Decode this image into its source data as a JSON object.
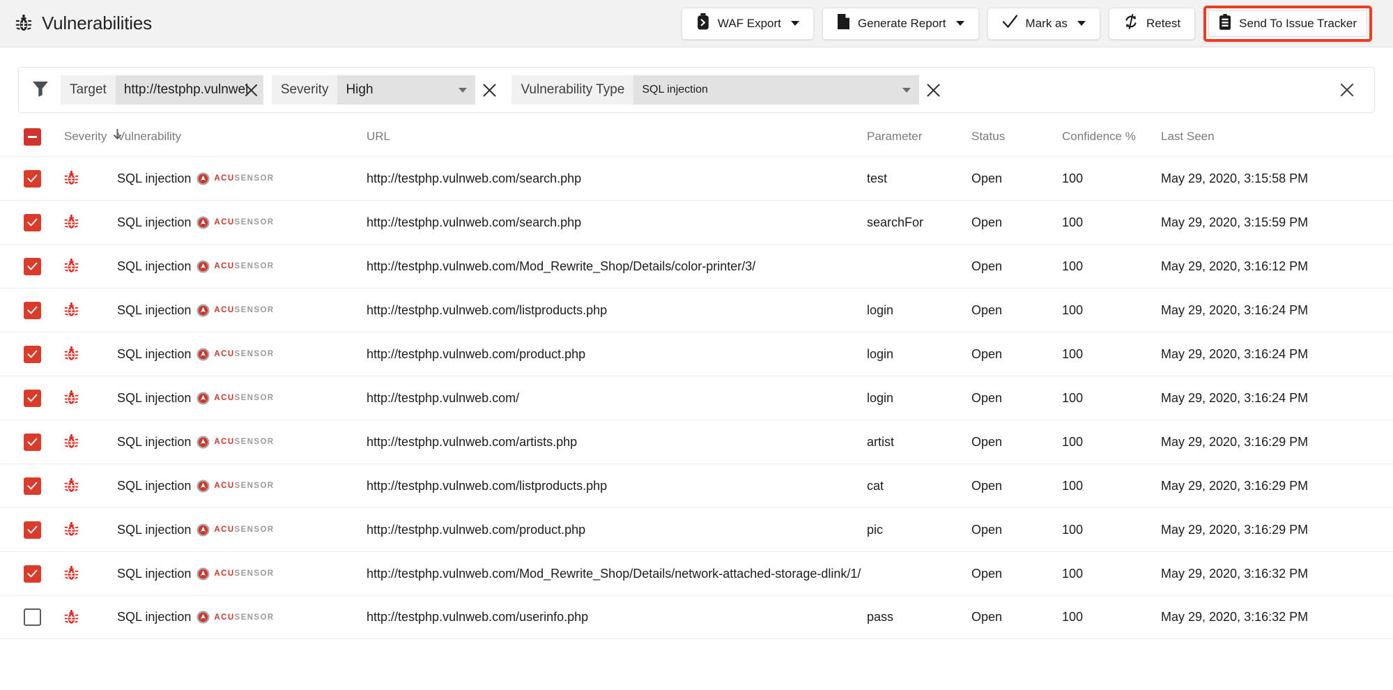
{
  "header": {
    "title": "Vulnerabilities",
    "icon": "bug-icon",
    "buttons": [
      {
        "label": "WAF Export",
        "icon": "waf-export-icon",
        "has_caret": true,
        "highlighted": false
      },
      {
        "label": "Generate Report",
        "icon": "document-icon",
        "has_caret": true,
        "highlighted": false
      },
      {
        "label": "Mark as",
        "icon": "check-icon",
        "has_caret": true,
        "highlighted": false
      },
      {
        "label": "Retest",
        "icon": "refresh-icon",
        "has_caret": false,
        "highlighted": false
      },
      {
        "label": "Send To Issue Tracker",
        "icon": "clipboard-icon",
        "has_caret": false,
        "highlighted": true
      }
    ],
    "highlight_color": "#ef3b24"
  },
  "filters": {
    "icon": "filter-funnel-icon",
    "clear_all_icon": "close-icon",
    "items": [
      {
        "key": "Target",
        "value": "http://testphp.vulnwel",
        "has_caret": false,
        "clear_icon": "close-icon"
      },
      {
        "key": "Severity",
        "value": "High",
        "has_caret": true,
        "clear_icon": "close-icon"
      },
      {
        "key": "Vulnerability Type",
        "value": "SQL injection",
        "has_caret": true,
        "clear_icon": "close-icon"
      }
    ]
  },
  "table": {
    "select_all_state": "indeterminate",
    "columns": [
      {
        "id": "severity",
        "label": "Severity",
        "sorted": true,
        "sort_dir": "down",
        "sort_icon": "arrow-down-icon"
      },
      {
        "id": "vulnerability",
        "label": "Vulnerability",
        "sorted": false
      },
      {
        "id": "url",
        "label": "URL",
        "sorted": false
      },
      {
        "id": "parameter",
        "label": "Parameter",
        "sorted": false
      },
      {
        "id": "status",
        "label": "Status",
        "sorted": false
      },
      {
        "id": "confidence",
        "label": "Confidence %",
        "sorted": false
      },
      {
        "id": "last_seen",
        "label": "Last Seen",
        "sorted": false
      }
    ],
    "badge": {
      "mark": "acusensor-logo-icon",
      "text_a": "ACU",
      "text_b": "SENSOR"
    },
    "severity_icon": "red-bug-icon",
    "rows": [
      {
        "selected": true,
        "vulnerability": "SQL injection",
        "url": "http://testphp.vulnweb.com/search.php",
        "parameter": "test",
        "status": "Open",
        "confidence": "100",
        "last_seen": "May 29, 2020, 3:15:58 PM"
      },
      {
        "selected": true,
        "vulnerability": "SQL injection",
        "url": "http://testphp.vulnweb.com/search.php",
        "parameter": "searchFor",
        "status": "Open",
        "confidence": "100",
        "last_seen": "May 29, 2020, 3:15:59 PM"
      },
      {
        "selected": true,
        "vulnerability": "SQL injection",
        "url": "http://testphp.vulnweb.com/Mod_Rewrite_Shop/Details/color-printer/3/",
        "parameter": "",
        "status": "Open",
        "confidence": "100",
        "last_seen": "May 29, 2020, 3:16:12 PM"
      },
      {
        "selected": true,
        "vulnerability": "SQL injection",
        "url": "http://testphp.vulnweb.com/listproducts.php",
        "parameter": "login",
        "status": "Open",
        "confidence": "100",
        "last_seen": "May 29, 2020, 3:16:24 PM"
      },
      {
        "selected": true,
        "vulnerability": "SQL injection",
        "url": "http://testphp.vulnweb.com/product.php",
        "parameter": "login",
        "status": "Open",
        "confidence": "100",
        "last_seen": "May 29, 2020, 3:16:24 PM"
      },
      {
        "selected": true,
        "vulnerability": "SQL injection",
        "url": "http://testphp.vulnweb.com/",
        "parameter": "login",
        "status": "Open",
        "confidence": "100",
        "last_seen": "May 29, 2020, 3:16:24 PM"
      },
      {
        "selected": true,
        "vulnerability": "SQL injection",
        "url": "http://testphp.vulnweb.com/artists.php",
        "parameter": "artist",
        "status": "Open",
        "confidence": "100",
        "last_seen": "May 29, 2020, 3:16:29 PM"
      },
      {
        "selected": true,
        "vulnerability": "SQL injection",
        "url": "http://testphp.vulnweb.com/listproducts.php",
        "parameter": "cat",
        "status": "Open",
        "confidence": "100",
        "last_seen": "May 29, 2020, 3:16:29 PM"
      },
      {
        "selected": true,
        "vulnerability": "SQL injection",
        "url": "http://testphp.vulnweb.com/product.php",
        "parameter": "pic",
        "status": "Open",
        "confidence": "100",
        "last_seen": "May 29, 2020, 3:16:29 PM"
      },
      {
        "selected": true,
        "vulnerability": "SQL injection",
        "url": "http://testphp.vulnweb.com/Mod_Rewrite_Shop/Details/network-attached-storage-dlink/1/",
        "parameter": "",
        "status": "Open",
        "confidence": "100",
        "last_seen": "May 29, 2020, 3:16:32 PM"
      },
      {
        "selected": false,
        "vulnerability": "SQL injection",
        "url": "http://testphp.vulnweb.com/userinfo.php",
        "parameter": "pass",
        "status": "Open",
        "confidence": "100",
        "last_seen": "May 29, 2020, 3:16:32 PM"
      }
    ]
  },
  "colors": {
    "accent_red": "#d0342a",
    "highlight_orange": "#ef3b24",
    "topbar_bg": "#f2f2f2",
    "chip_key_bg": "#f1f1f1",
    "chip_value_bg": "#e2e2e2",
    "header_text": "#7b7b7b"
  }
}
